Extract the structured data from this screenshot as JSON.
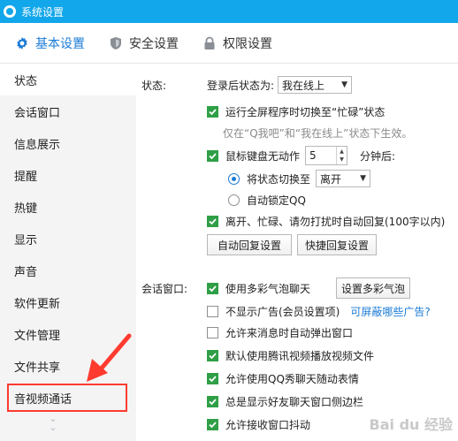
{
  "window": {
    "title": "系统设置"
  },
  "tabs": [
    {
      "label": "基本设置",
      "icon": "gear-icon",
      "active": true
    },
    {
      "label": "安全设置",
      "icon": "shield-icon",
      "active": false
    },
    {
      "label": "权限设置",
      "icon": "lock-icon",
      "active": false
    }
  ],
  "sidebar": {
    "items": [
      {
        "label": "状态",
        "active": true
      },
      {
        "label": "会话窗口"
      },
      {
        "label": "信息展示"
      },
      {
        "label": "提醒"
      },
      {
        "label": "热键"
      },
      {
        "label": "显示"
      },
      {
        "label": "声音"
      },
      {
        "label": "软件更新"
      },
      {
        "label": "文件管理"
      },
      {
        "label": "文件共享"
      },
      {
        "label": "音视频通话",
        "highlighted": true
      }
    ]
  },
  "status": {
    "section_label": "状态:",
    "login_label": "登录后状态为:",
    "login_value": "我在线上",
    "fullscreen_label": "运行全屏程序时切换至“忙碌”状态",
    "fullscreen_checked": true,
    "fullscreen_hint": "仅在“Q我吧”和“我在线上”状态下生效。",
    "idle_label": "鼠标键盘无动作",
    "idle_checked": true,
    "idle_minutes": "5",
    "idle_unit": "分钟后:",
    "switch_label": "将状态切换至",
    "switch_value": "离开",
    "switch_selected": true,
    "autolock_label": "自动锁定QQ",
    "autolock_selected": false,
    "autoreply_label": "离开、忙碌、请勿打扰时自动回复(100字以内)",
    "autoreply_checked": true,
    "autoreply_button": "自动回复设置",
    "quickreply_button": "快捷回复设置"
  },
  "session": {
    "section_label": "会话窗口:",
    "options": [
      {
        "label": "使用多彩气泡聊天",
        "checked": true
      },
      {
        "label": "不显示广告(会员设置项)",
        "checked": false
      },
      {
        "label": "允许来消息时自动弹出窗口",
        "checked": false
      },
      {
        "label": "默认使用腾讯视频播放视频文件",
        "checked": true
      },
      {
        "label": "允许使用QQ秀聊天随动表情",
        "checked": true
      },
      {
        "label": "总是显示好友聊天窗口侧边栏",
        "checked": true
      },
      {
        "label": "允许接收窗口抖动",
        "checked": true
      }
    ],
    "bubble_button": "设置多彩气泡",
    "ads_link": "可屏蔽哪些广告?"
  },
  "watermark": "Bai du 经验",
  "colors": {
    "titlebar": "#12a7ea",
    "accent": "#1a7bd6",
    "check": "#2f9f46",
    "annotation": "#ff3b30"
  }
}
